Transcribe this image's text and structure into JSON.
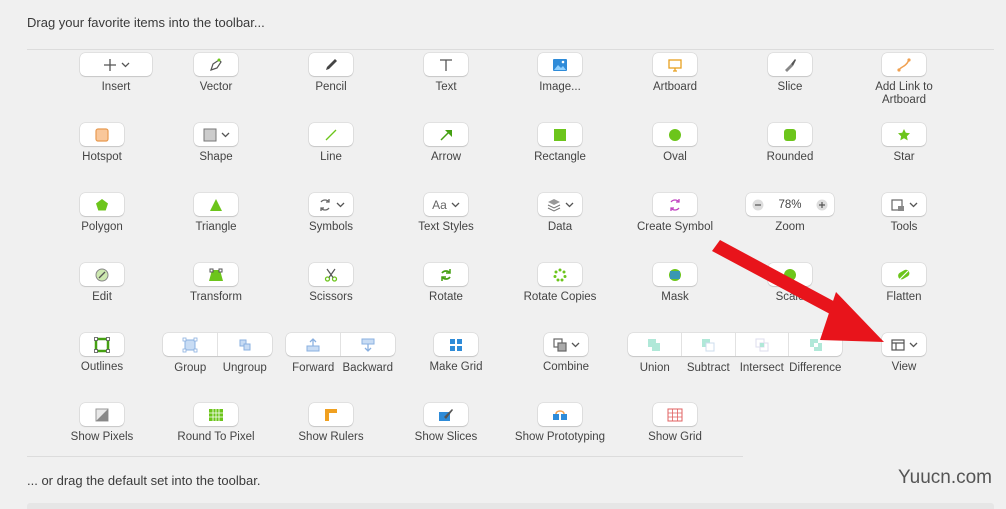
{
  "header": {
    "text": "Drag your favorite items into the toolbar..."
  },
  "footer": {
    "text": "... or drag the default set into the toolbar."
  },
  "watermark": "Yuucn.com",
  "rows": [
    [
      "Insert",
      "Vector",
      "Pencil",
      "Text",
      "Image...",
      "Artboard",
      "Slice",
      "Add Link to Artboard"
    ],
    [
      "Hotspot",
      "Shape",
      "Line",
      "Arrow",
      "Rectangle",
      "Oval",
      "Rounded",
      "Star"
    ],
    [
      "Polygon",
      "Triangle",
      "Symbols",
      "Text Styles",
      "Data",
      "Create Symbol",
      "Zoom",
      "Tools"
    ],
    [
      "Edit",
      "Transform",
      "Scissors",
      "Rotate",
      "Rotate Copies",
      "Mask",
      "Scale",
      "Flatten"
    ]
  ],
  "row5": {
    "outlines": "Outlines",
    "group": "Group",
    "ungroup": "Ungroup",
    "forward": "Forward",
    "backward": "Backward",
    "make_grid": "Make Grid",
    "combine": "Combine",
    "union": "Union",
    "subtract": "Subtract",
    "intersect": "Intersect",
    "difference": "Difference",
    "view": "View"
  },
  "row6": [
    "Show Pixels",
    "Round To Pixel",
    "Show Rulers",
    "Show Slices",
    "Show Prototyping",
    "Show Grid"
  ],
  "zoom": {
    "value": "78%"
  },
  "colors": {
    "accent_green": "#6cc51b",
    "arrow_red": "#e8141b",
    "orange": "#f0a050"
  }
}
